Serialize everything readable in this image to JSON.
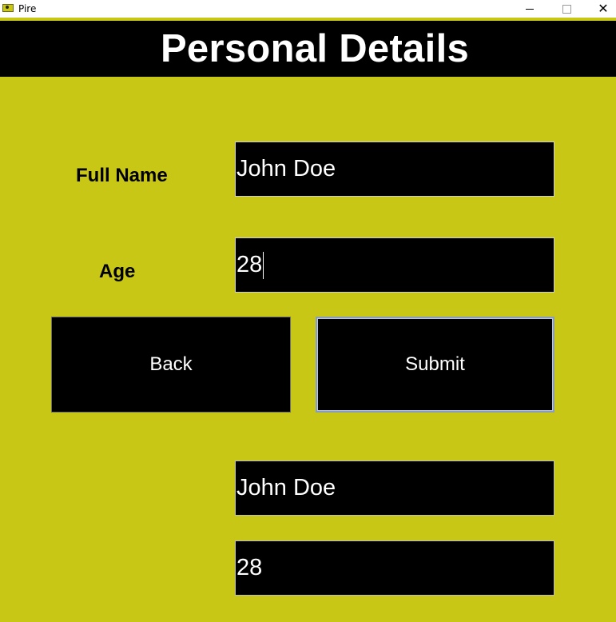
{
  "window": {
    "title": "Pire",
    "minimize_glyph": "",
    "maximize_glyph": "",
    "close_glyph": "✕"
  },
  "header": {
    "title": "Personal Details"
  },
  "form": {
    "full_name_label": "Full Name",
    "full_name_value": "John Doe",
    "age_label": "Age",
    "age_value": "28"
  },
  "buttons": {
    "back_label": "Back",
    "submit_label": "Submit"
  },
  "output": {
    "name_value": "John Doe",
    "age_value": "28"
  },
  "colors": {
    "background": "#c9c716",
    "panel": "#000000",
    "text_light": "#ffffff"
  }
}
